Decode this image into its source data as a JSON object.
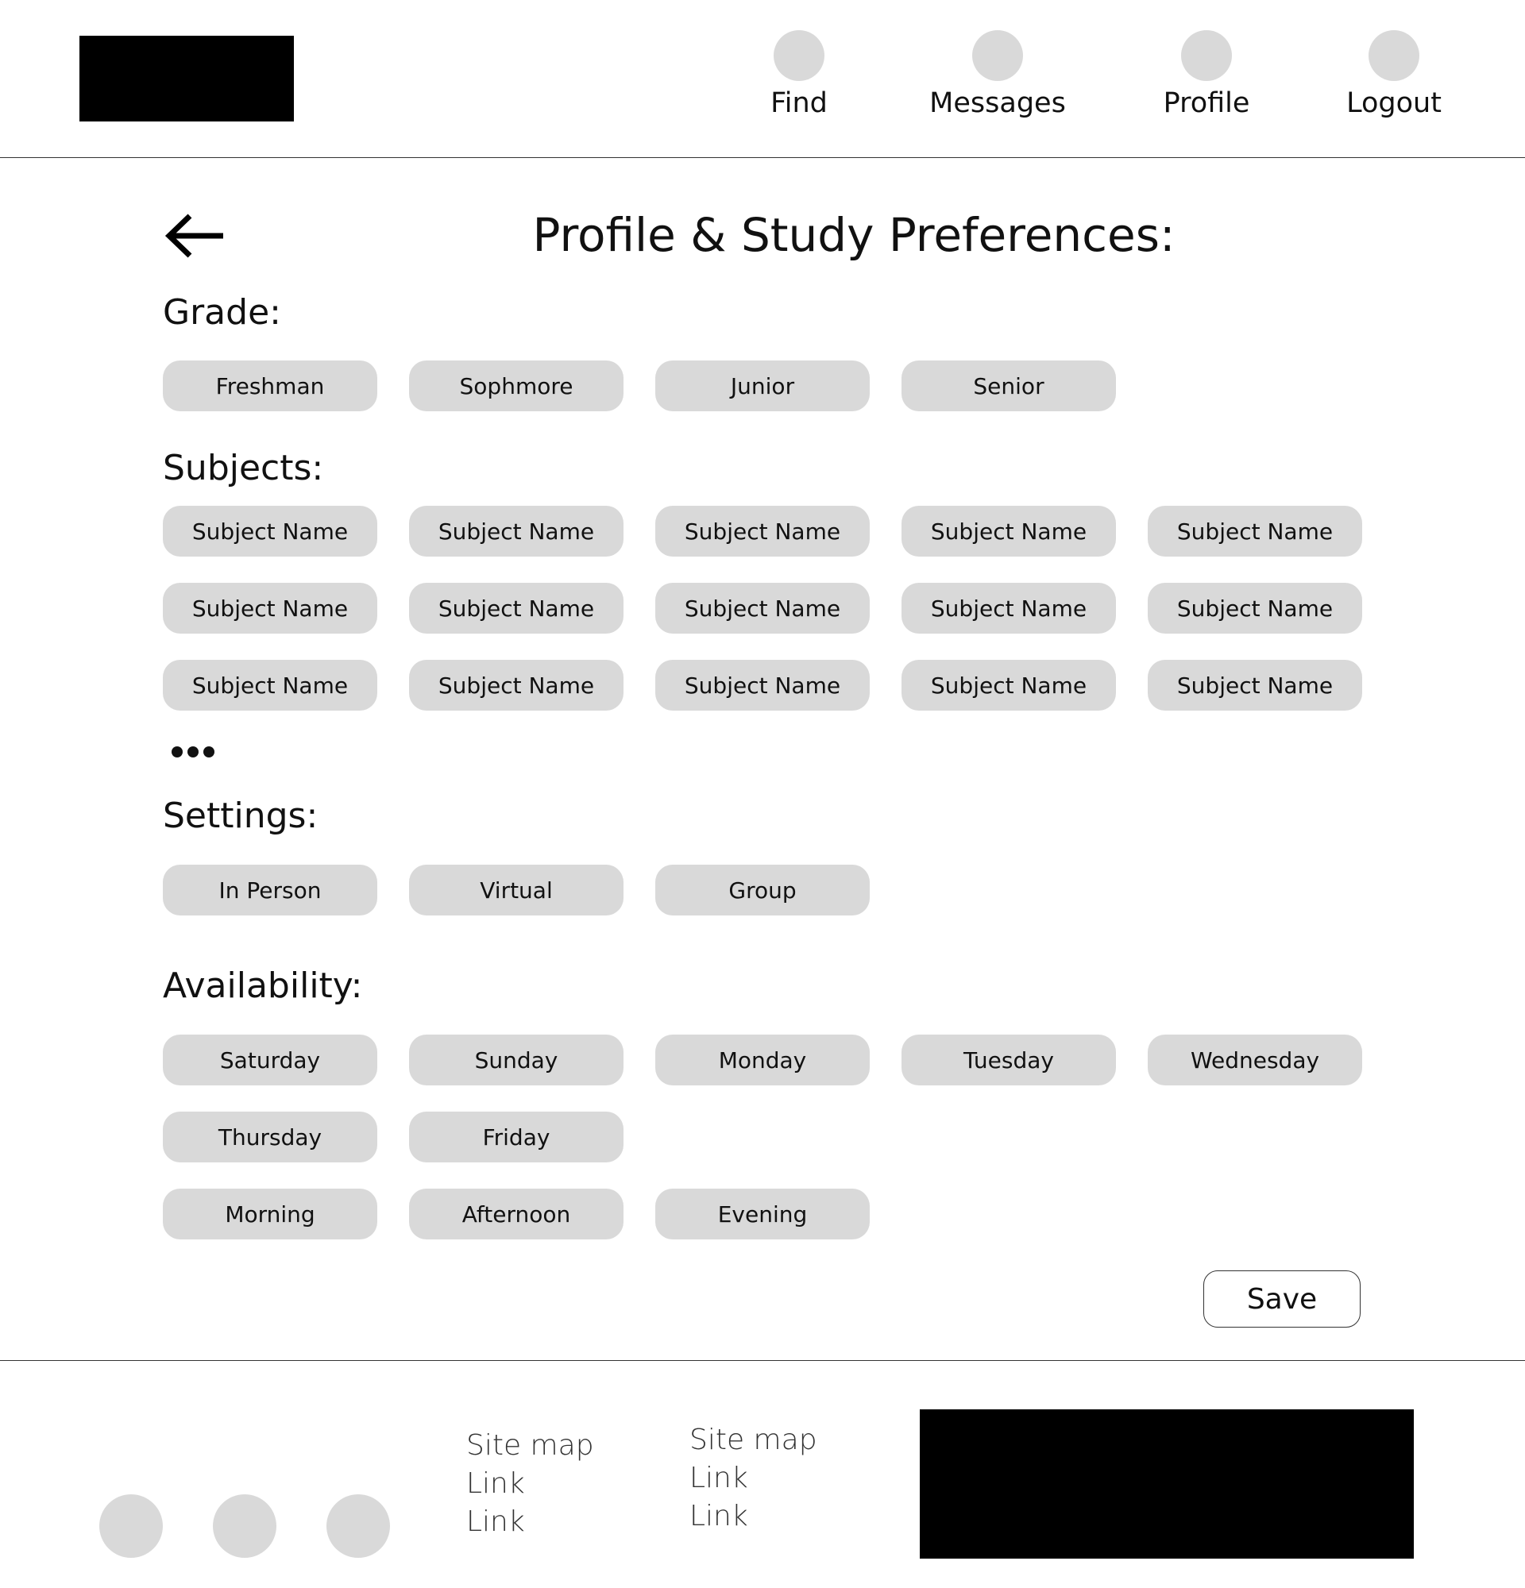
{
  "header": {
    "nav": [
      {
        "label": "Find"
      },
      {
        "label": "Messages"
      },
      {
        "label": "Profile"
      },
      {
        "label": "Logout"
      }
    ]
  },
  "page": {
    "title": "Profile & Study Preferences:"
  },
  "grade": {
    "label": "Grade:",
    "options": [
      "Freshman",
      "Sophmore",
      "Junior",
      "Senior"
    ]
  },
  "subjects": {
    "label": "Subjects:",
    "options": [
      "Subject Name",
      "Subject Name",
      "Subject Name",
      "Subject Name",
      "Subject Name",
      "Subject Name",
      "Subject Name",
      "Subject Name",
      "Subject Name",
      "Subject Name",
      "Subject Name",
      "Subject Name",
      "Subject Name",
      "Subject Name",
      "Subject Name"
    ]
  },
  "settings": {
    "label": "Settings:",
    "options": [
      "In Person",
      "Virtual",
      "Group"
    ]
  },
  "availability": {
    "label": "Availability:",
    "days": [
      "Saturday",
      "Sunday",
      "Monday",
      "Tuesday",
      "Wednesday",
      "Thursday",
      "Friday"
    ],
    "times": [
      "Morning",
      "Afternoon",
      "Evening"
    ]
  },
  "actions": {
    "save_label": "Save"
  },
  "footer": {
    "columns": [
      [
        "Site map",
        "Link",
        "Link"
      ],
      [
        "Site map",
        "Link",
        "Link"
      ]
    ]
  },
  "icons": {
    "back": "arrow-left-icon",
    "more": "ellipsis-icon"
  },
  "colors": {
    "chip_bg": "#d9d9d9",
    "placeholder_black": "#000000",
    "text": "#111111"
  }
}
